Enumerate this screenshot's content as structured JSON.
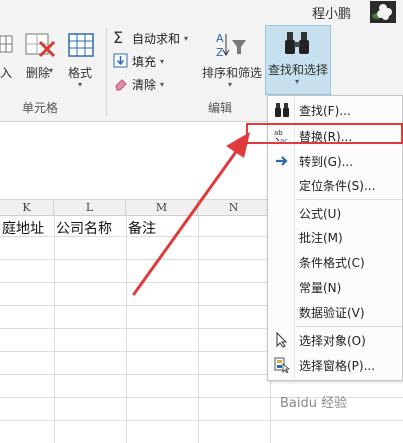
{
  "user": {
    "name": "程小鹏"
  },
  "ribbon": {
    "cells_group": {
      "insert_label": "入",
      "delete_label": "删除",
      "format_label": "格式",
      "group_label": "单元格"
    },
    "edit_group": {
      "autosum_label": "自动求和",
      "fill_label": "填充",
      "clear_label": "清除",
      "sort_filter_label": "排序和筛选",
      "find_select_label": "查找和选择",
      "group_label": "编辑"
    }
  },
  "sheet": {
    "columns": [
      "K",
      "L",
      "M",
      "N"
    ],
    "row1": [
      "庭地址",
      "公司名称",
      "备注"
    ]
  },
  "menu": {
    "items": [
      {
        "label": "查找(F)...",
        "icon": "binoculars-icon"
      },
      {
        "label": "替换(R)...",
        "icon": "replace-icon"
      },
      {
        "label": "转到(G)...",
        "icon": "arrow-right-icon"
      },
      {
        "label": "定位条件(S)...",
        "icon": "none"
      },
      {
        "label": "公式(U)",
        "icon": "none"
      },
      {
        "label": "批注(M)",
        "icon": "none"
      },
      {
        "label": "条件格式(C)",
        "icon": "none"
      },
      {
        "label": "常量(N)",
        "icon": "none"
      },
      {
        "label": "数据验证(V)",
        "icon": "none"
      },
      {
        "label": "选择对象(O)",
        "icon": "cursor-icon"
      },
      {
        "label": "选择窗格(P)...",
        "icon": "selection-pane-icon"
      }
    ]
  },
  "annotation": {
    "color": "#e03a3a"
  },
  "watermark": {
    "text": "Baidu 经验"
  }
}
